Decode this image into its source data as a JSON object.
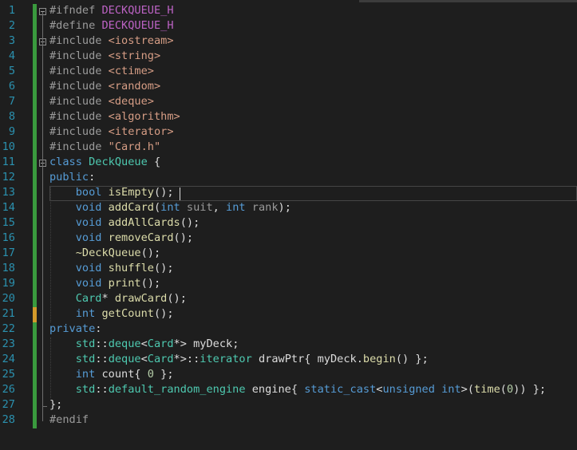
{
  "file": {
    "line_numbers": [
      "1",
      "2",
      "3",
      "4",
      "5",
      "6",
      "7",
      "8",
      "9",
      "10",
      "11",
      "12",
      "13",
      "14",
      "15",
      "16",
      "17",
      "18",
      "19",
      "20",
      "21",
      "22",
      "23",
      "24",
      "25",
      "26",
      "27",
      "28"
    ],
    "lines": [
      [
        {
          "t": "#ifndef ",
          "c": "pp"
        },
        {
          "t": "DECKQUEUE_H",
          "c": "mac"
        }
      ],
      [
        {
          "t": "#define ",
          "c": "pp"
        },
        {
          "t": "DECKQUEUE_H",
          "c": "mac"
        }
      ],
      [
        {
          "t": "#include ",
          "c": "pp"
        },
        {
          "t": "<iostream>",
          "c": "str"
        }
      ],
      [
        {
          "t": "#include ",
          "c": "pp"
        },
        {
          "t": "<string>",
          "c": "str"
        }
      ],
      [
        {
          "t": "#include ",
          "c": "pp"
        },
        {
          "t": "<ctime>",
          "c": "str"
        }
      ],
      [
        {
          "t": "#include ",
          "c": "pp"
        },
        {
          "t": "<random>",
          "c": "str"
        }
      ],
      [
        {
          "t": "#include ",
          "c": "pp"
        },
        {
          "t": "<deque>",
          "c": "str"
        }
      ],
      [
        {
          "t": "#include ",
          "c": "pp"
        },
        {
          "t": "<algorithm>",
          "c": "str"
        }
      ],
      [
        {
          "t": "#include ",
          "c": "pp"
        },
        {
          "t": "<iterator>",
          "c": "str"
        }
      ],
      [
        {
          "t": "#include ",
          "c": "pp"
        },
        {
          "t": "\"Card.h\"",
          "c": "str"
        }
      ],
      [
        {
          "t": "class ",
          "c": "kw"
        },
        {
          "t": "DeckQueue",
          "c": "ty"
        },
        {
          "t": " {",
          "c": ""
        }
      ],
      [
        {
          "t": "public",
          "c": "kw"
        },
        {
          "t": ":",
          "c": ""
        }
      ],
      [
        {
          "t": "    ",
          "c": ""
        },
        {
          "t": "bool ",
          "c": "kw"
        },
        {
          "t": "isEmpty",
          "c": "fn"
        },
        {
          "t": "();",
          "c": ""
        }
      ],
      [
        {
          "t": "    ",
          "c": ""
        },
        {
          "t": "void ",
          "c": "kw"
        },
        {
          "t": "addCard",
          "c": "fn"
        },
        {
          "t": "(",
          "c": ""
        },
        {
          "t": "int ",
          "c": "kw"
        },
        {
          "t": "suit",
          "c": "par"
        },
        {
          "t": ", ",
          "c": ""
        },
        {
          "t": "int ",
          "c": "kw"
        },
        {
          "t": "rank",
          "c": "par"
        },
        {
          "t": ");",
          "c": ""
        }
      ],
      [
        {
          "t": "    ",
          "c": ""
        },
        {
          "t": "void ",
          "c": "kw"
        },
        {
          "t": "addAllCards",
          "c": "fn"
        },
        {
          "t": "();",
          "c": ""
        }
      ],
      [
        {
          "t": "    ",
          "c": ""
        },
        {
          "t": "void ",
          "c": "kw"
        },
        {
          "t": "removeCard",
          "c": "fn"
        },
        {
          "t": "();",
          "c": ""
        }
      ],
      [
        {
          "t": "    ",
          "c": ""
        },
        {
          "t": "~DeckQueue",
          "c": "fn"
        },
        {
          "t": "();",
          "c": ""
        }
      ],
      [
        {
          "t": "    ",
          "c": ""
        },
        {
          "t": "void ",
          "c": "kw"
        },
        {
          "t": "shuffle",
          "c": "fn"
        },
        {
          "t": "();",
          "c": ""
        }
      ],
      [
        {
          "t": "    ",
          "c": ""
        },
        {
          "t": "void ",
          "c": "kw"
        },
        {
          "t": "print",
          "c": "fn"
        },
        {
          "t": "();",
          "c": ""
        }
      ],
      [
        {
          "t": "    ",
          "c": ""
        },
        {
          "t": "Card",
          "c": "ty"
        },
        {
          "t": "* ",
          "c": ""
        },
        {
          "t": "drawCard",
          "c": "fn"
        },
        {
          "t": "();",
          "c": ""
        }
      ],
      [
        {
          "t": "    ",
          "c": ""
        },
        {
          "t": "int ",
          "c": "kw"
        },
        {
          "t": "getCount",
          "c": "fn"
        },
        {
          "t": "();",
          "c": ""
        }
      ],
      [
        {
          "t": "private",
          "c": "kw"
        },
        {
          "t": ":",
          "c": ""
        }
      ],
      [
        {
          "t": "    ",
          "c": ""
        },
        {
          "t": "std",
          "c": "ty"
        },
        {
          "t": "::",
          "c": ""
        },
        {
          "t": "deque",
          "c": "ty"
        },
        {
          "t": "<",
          "c": ""
        },
        {
          "t": "Card",
          "c": "ty"
        },
        {
          "t": "*> ",
          "c": ""
        },
        {
          "t": "myDeck",
          "c": ""
        },
        {
          "t": ";",
          "c": ""
        }
      ],
      [
        {
          "t": "    ",
          "c": ""
        },
        {
          "t": "std",
          "c": "ty"
        },
        {
          "t": "::",
          "c": ""
        },
        {
          "t": "deque",
          "c": "ty"
        },
        {
          "t": "<",
          "c": ""
        },
        {
          "t": "Card",
          "c": "ty"
        },
        {
          "t": "*>::",
          "c": ""
        },
        {
          "t": "iterator",
          "c": "ty"
        },
        {
          "t": " drawPtr{ myDeck.",
          "c": ""
        },
        {
          "t": "begin",
          "c": "fn"
        },
        {
          "t": "() };",
          "c": ""
        }
      ],
      [
        {
          "t": "    ",
          "c": ""
        },
        {
          "t": "int ",
          "c": "kw"
        },
        {
          "t": "count{ ",
          "c": ""
        },
        {
          "t": "0",
          "c": "num"
        },
        {
          "t": " };",
          "c": ""
        }
      ],
      [
        {
          "t": "    ",
          "c": ""
        },
        {
          "t": "std",
          "c": "ty"
        },
        {
          "t": "::",
          "c": ""
        },
        {
          "t": "default_random_engine",
          "c": "ty"
        },
        {
          "t": " engine{ ",
          "c": ""
        },
        {
          "t": "static_cast",
          "c": "kw"
        },
        {
          "t": "<",
          "c": ""
        },
        {
          "t": "unsigned int",
          "c": "kw"
        },
        {
          "t": ">(",
          "c": ""
        },
        {
          "t": "time",
          "c": "fn"
        },
        {
          "t": "(",
          "c": ""
        },
        {
          "t": "0",
          "c": "num"
        },
        {
          "t": ")) };",
          "c": ""
        }
      ],
      [
        {
          "t": "};",
          "c": ""
        }
      ],
      [
        {
          "t": "#endif",
          "c": "pp"
        }
      ]
    ]
  }
}
